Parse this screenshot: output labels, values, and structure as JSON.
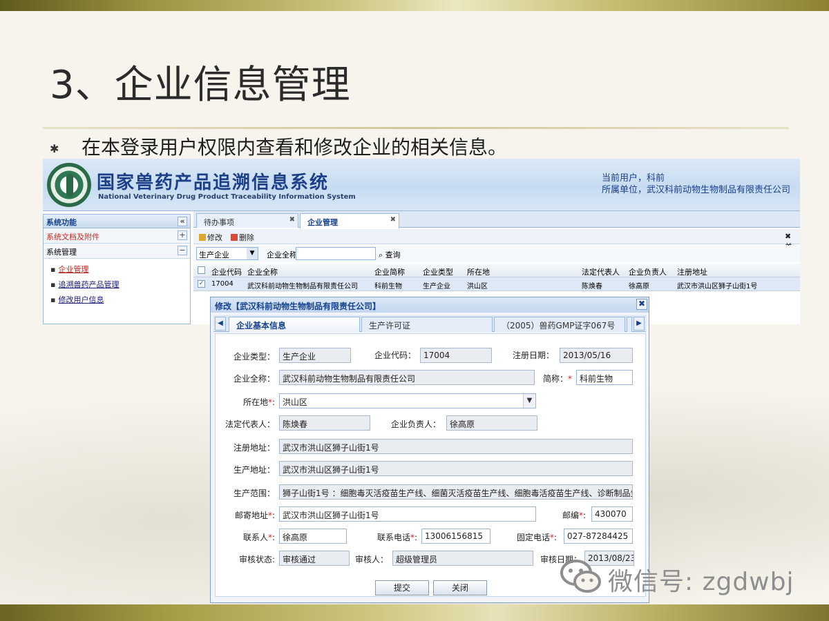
{
  "slide": {
    "title": "3、企业信息管理",
    "bullet": "✱",
    "bullet_text": "在本登录用户权限内查看和修改企业的相关信息。"
  },
  "app": {
    "system_title": "国家兽药产品追溯信息系统",
    "system_subtitle": "National Veterinary Drug Product Traceability Information System",
    "current_user": "当前用户，科前",
    "current_unit": "所属单位，武汉科前动物生物制品有限责任公司",
    "left_panel": {
      "header": "系统功能",
      "collapse": "«",
      "sections": [
        {
          "label": "系统文档及附件",
          "button": "+"
        },
        {
          "label": "系统管理",
          "button": "−"
        }
      ],
      "links": [
        "企业管理",
        "追溯兽药产品管理",
        "修改用户信息"
      ]
    },
    "tabs": [
      {
        "label": "待办事项",
        "close": "✖"
      },
      {
        "label": "企业管理",
        "close": "✖"
      }
    ],
    "toolbar": {
      "edit": "修改",
      "delete": "删除",
      "right_hint": "✖ 关"
    },
    "search": {
      "type_value": "生产企业",
      "name_label": "企业全称",
      "query_label": "查询"
    },
    "grid": {
      "headers": [
        "企业代码",
        "企业全称",
        "企业简称",
        "企业类型",
        "所在地",
        "法定代表人",
        "企业负责人",
        "注册地址"
      ],
      "row": [
        "17004",
        "武汉科前动物生物制品有限责任公司",
        "科前生物",
        "生产企业",
        "洪山区",
        "陈焕春",
        "徐高原",
        "武汉市洪山区狮子山街1号"
      ]
    }
  },
  "modal": {
    "title": "修改【武汉科前动物生物制品有限责任公司】",
    "close": "✖",
    "tabs": [
      "企业基本信息",
      "生产许可证",
      "（2005）兽药GMP证字067号",
      "（"
    ],
    "fields": {
      "type_label": "企业类型：",
      "type_value": "生产企业",
      "code_label": "企业代码：",
      "code_value": "17004",
      "reg_date_label": "注册日期：",
      "reg_date_value": "2013/05/16",
      "fullname_label": "企业全称：",
      "fullname_value": "武汉科前动物生物制品有限责任公司",
      "short_label": "简称：",
      "short_value": "科前生物",
      "location_label": "所在地",
      "location_value": "洪山区",
      "legal_label": "法定代表人：",
      "legal_value": "陈焕春",
      "manager_label": "企业负责人：",
      "manager_value": "徐高原",
      "reg_addr_label": "注册地址：",
      "reg_addr_value": "武汉市洪山区狮子山街1号",
      "prod_addr_label": "生产地址：",
      "prod_addr_value": "武汉市洪山区狮子山街1号",
      "scope_label": "生产范围：",
      "scope_value": "狮子山街1号 ：细胞毒灭活疫苗生产线、细菌灭活疫苗生产线、细胞毒活疫苗生产线、诊断制品生",
      "mail_addr_label": "邮寄地址",
      "mail_addr_value": "武汉市洪山区狮子山街1号",
      "zip_label": "邮编",
      "zip_value": "430070",
      "contact_label": "联系人",
      "contact_value": "徐高原",
      "phone_label": "联系电话",
      "phone_value": "13006156815",
      "fixed_phone_label": "固定电话",
      "fixed_phone_value": "027-87284425",
      "audit_status_label": "审核状态:",
      "audit_status_value": "审核通过",
      "auditor_label": "审核人：",
      "auditor_value": "超级管理员",
      "audit_date_label": "审核日期：",
      "audit_date_value": "2013/08/23"
    },
    "submit": "提交",
    "close_button": "关闭"
  },
  "watermark": {
    "text": "微信号: zgdwbj",
    "icon": "wechat-icon"
  }
}
